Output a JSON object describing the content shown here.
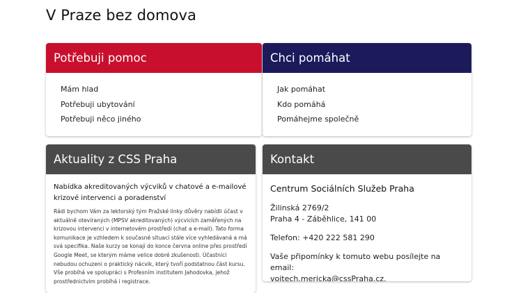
{
  "page": {
    "title": "V Praze bez domova"
  },
  "help_card": {
    "title": "Potřebuji pomoc",
    "links": [
      "Mám hlad",
      "Potřebuji ubytování",
      "Potřebuji něco jiného"
    ],
    "accent": "#c8102e"
  },
  "give_card": {
    "title": "Chci pomáhat",
    "links": [
      "Jak pomáhat",
      "Kdo pomáhá",
      "Pomáhejme společně"
    ],
    "accent": "#1d1a5c"
  },
  "news_card": {
    "title": "Aktuality z CSS Praha",
    "article_title": "Nabídka akreditovaných výcviků v chatové a e-mailové krizové intervenci a poradenství",
    "article_text": "Rádi bychom Vám za lektorský tým Pražské linky důvěry nabídli účast v aktuálně otevíraných (MPSV akreditovaných) výcvicích zaměřených na krizovou intervenci v internetovém prostředí (chat a e-mail). Tato forma komunikace je vzhledem k současné situaci stále více vyhledávaná a má svá specifika. Naše kurzy se konají do konce června online přes prostředí Google Meet, se kterým máme velice dobré zkušenosti. Účastníci nebudou ochuzeni o praktický nácvik, který tvoří podstatnou část kursu. Vše probíhá ve spolupráci s Profesním institutem Jahodovka, jehož prostřednictvím probíhá i registrace.",
    "accent": "#4a4a4a"
  },
  "contact_card": {
    "title": "Kontakt",
    "org_name": "Centrum Sociálních Služeb Praha",
    "street": "Žilinská 2769/2",
    "city": "Praha 4 - Záběhlice, 141 00",
    "phone": "Telefon: +420 222 581 290",
    "feedback": "Vaše připomínky k tomuto webu posílejte na email:",
    "email": "vojtech.mericka@cssPraha.cz.",
    "accent": "#4a4a4a"
  }
}
